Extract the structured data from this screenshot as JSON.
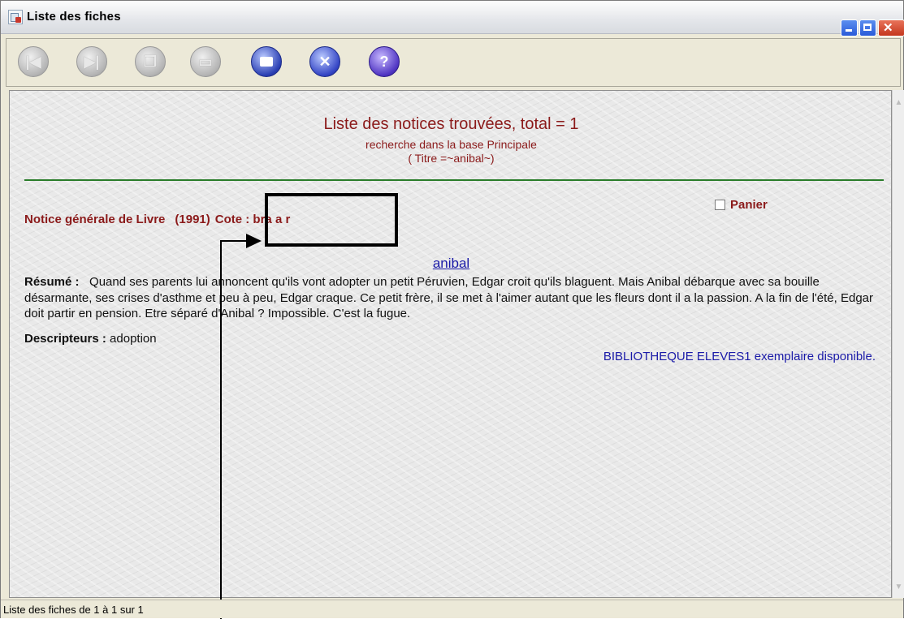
{
  "window": {
    "title": "Liste des fiches"
  },
  "toolbar": {
    "buttons": [
      {
        "name": "first-record",
        "icon": "first-icon",
        "enabled": false
      },
      {
        "name": "last-record",
        "icon": "last-icon",
        "enabled": false
      },
      {
        "name": "new-record",
        "icon": "add-icon",
        "enabled": false
      },
      {
        "name": "edit-record",
        "icon": "edit-icon",
        "enabled": false
      },
      {
        "name": "print",
        "icon": "printer-icon",
        "enabled": true
      },
      {
        "name": "cancel",
        "icon": "close-icon",
        "enabled": true
      },
      {
        "name": "help",
        "icon": "help-icon",
        "enabled": true
      }
    ]
  },
  "results": {
    "title": "Liste des notices trouvées, total = 1",
    "subtitle": "recherche dans la base Principale",
    "query": "( Titre =~anibal~)"
  },
  "panier": {
    "label": "Panier",
    "checked": false
  },
  "notice": {
    "type_label": "Notice générale de  Livre",
    "year": "(1991)",
    "cote": "Cote : bra a r",
    "title": "anibal",
    "resume_label": "Résumé :",
    "resume_text": "Quand ses parents lui annoncent qu'ils vont adopter un petit Péruvien, Edgar croit qu'ils blaguent. Mais Anibal débarque avec sa bouille désarmante, ses crises d'asthme et peu à peu, Edgar craque. Ce petit frère, il se met à l'aimer autant que les fleurs dont il a la passion. A la fin de l'été, Edgar doit partir en pension. Etre séparé d'Anibal ? Impossible. C'est la fugue.",
    "descripteurs_label": "Descripteurs :",
    "descripteurs_value": "adoption",
    "availability": "BIBLIOTHEQUE ELEVES1 exemplaire disponible."
  },
  "statusbar": {
    "text": "Liste des fiches de 1 à 1 sur 1"
  },
  "colors": {
    "accent_red": "#8b1a1a",
    "link_blue": "#1a1aa8",
    "separator_green": "#2a7d2a"
  }
}
